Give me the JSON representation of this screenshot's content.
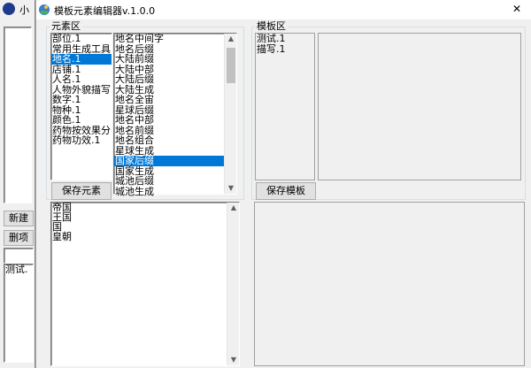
{
  "bg_window": {
    "title_char": "小",
    "buttons": [
      "新建",
      "删项"
    ],
    "list_items": [
      "测试."
    ]
  },
  "window": {
    "title": "模板元素编辑器v.1.0.0",
    "close_label": "✕"
  },
  "element_panel": {
    "group_label": "元素区",
    "categories": [
      "部位.1",
      "常用生成工具",
      "地名.1",
      "店铺.1",
      "人名.1",
      "人物外貌描写",
      "数字.1",
      "物种.1",
      "颜色.1",
      "药物按效果分",
      "药物功效.1"
    ],
    "selected_category": 2,
    "elements": [
      "地名中间字",
      "地名后缀",
      "大陆前缀",
      "大陆中部",
      "大陆后缀",
      "大陆生成",
      "地名全宙",
      "星球后缀",
      "地名中部",
      "地名前缀",
      "地名组合",
      "星球生成",
      "国家后缀",
      "国家生成",
      "城池后缀",
      "城池生成"
    ],
    "selected_element": 12,
    "save_button": "保存元素",
    "content_lines": [
      "帝国",
      "王国",
      "国",
      "皇朝"
    ]
  },
  "template_panel": {
    "group_label": "模板区",
    "templates": [
      "测试.1",
      "描写.1"
    ],
    "save_button": "保存模板"
  }
}
